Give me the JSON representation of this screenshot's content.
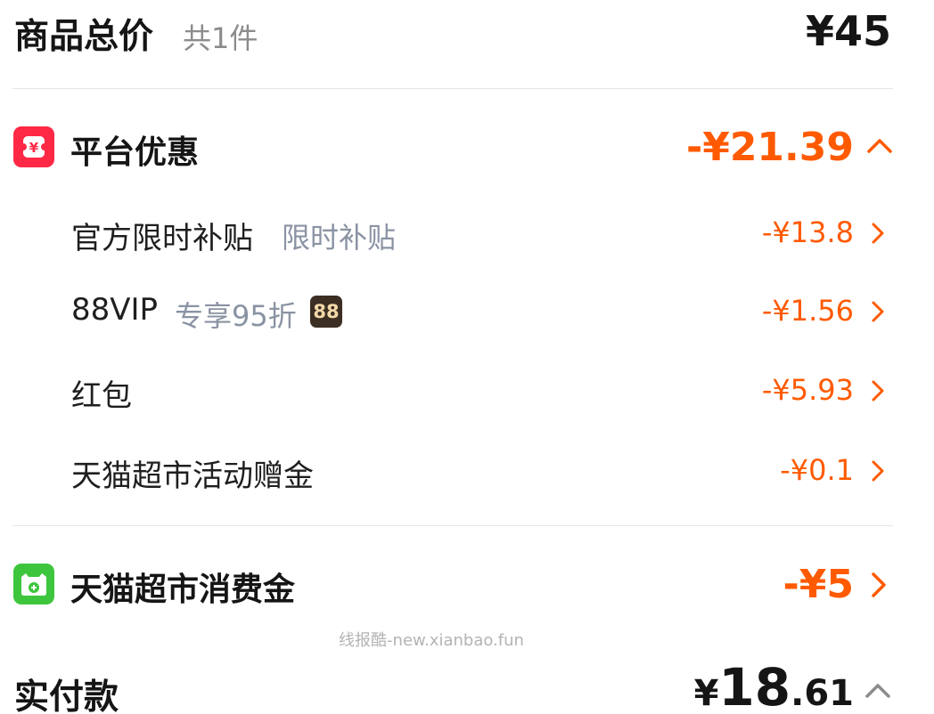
{
  "summary": {
    "title": "商品总价",
    "count": "共1件",
    "total": "¥45"
  },
  "platform_discount": {
    "title": "平台优惠",
    "amount": "-¥21.39",
    "icon": "coupon-icon",
    "icon_color": "#ff2845",
    "items": [
      {
        "label": "官方限时补贴",
        "note": "限时补贴",
        "amount": "-¥13.8"
      },
      {
        "label": "88VIP",
        "note": "专享95折",
        "badge": "88",
        "amount": "-¥1.56"
      },
      {
        "label": "红包",
        "amount": "-¥5.93"
      },
      {
        "label": "天猫超市活动赠金",
        "amount": "-¥0.1"
      }
    ]
  },
  "consumption_gold": {
    "title": "天猫超市消费金",
    "amount": "-¥5",
    "icon": "tmall-cat-icon",
    "icon_color": "#3dc63d"
  },
  "watermark": "线报酷-new.xianbao.fun",
  "payment": {
    "title": "实付款",
    "currency": "¥",
    "integer": "18",
    "decimal": ".61"
  },
  "colors": {
    "accent_orange": "#ff5a00",
    "text_dark": "#151515",
    "text_gray": "#8c8c8c"
  }
}
